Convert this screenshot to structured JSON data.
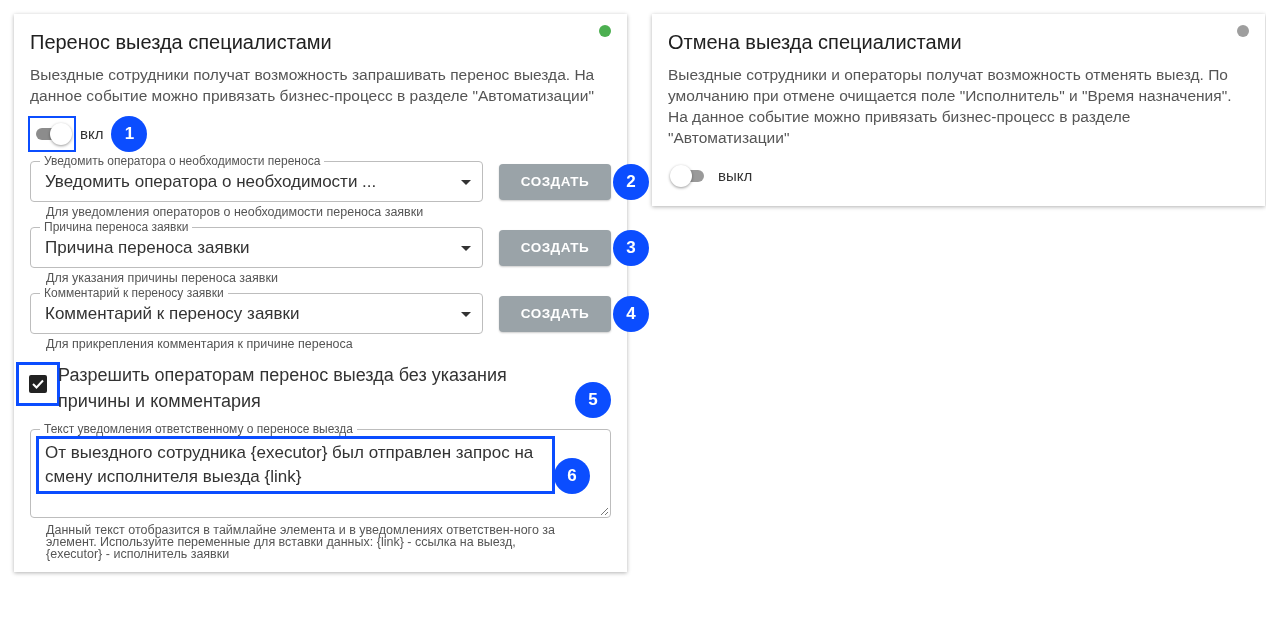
{
  "cards": [
    {
      "title": "Перенос выезда специалистами",
      "color": "#4caf50",
      "description": "Выездные сотрудники получат возможность запрашивать перенос выезда. На данное событие можно привязать бизнес-процесс в разделе \"Автоматизации\"",
      "toggle": {
        "label": "вкл",
        "on": true,
        "highlighted": true,
        "callout": "1"
      },
      "selects": [
        {
          "label": "Уведомить оператора о необходимости переноса",
          "value": "Уведомить оператора о необходимости ...",
          "helper": "Для уведомления операторов о необходимости переноса заявки",
          "button": "СОЗДАТЬ",
          "callout": "2"
        },
        {
          "label": "Причина переноса заявки",
          "value": "Причина переноса заявки",
          "helper": "Для указания причины переноса заявки",
          "button": "СОЗДАТЬ",
          "callout": "3"
        },
        {
          "label": "Комментарий к переносу заявки",
          "value": "Комментарий к переносу заявки",
          "helper": "Для прикрепления комментария к причине переноса",
          "button": "СОЗДАТЬ",
          "callout": "4"
        }
      ],
      "checkbox": {
        "label": "Разрешить операторам перенос выезда без указания причины и комментария",
        "checked": true,
        "highlighted": true,
        "callout": "5"
      },
      "textarea": {
        "label": "Текст уведомления ответственному о переносе выезда",
        "value": "От выездного сотрудника {executor} был отправлен запрос на смену исполнителя выезда {link}",
        "highlighted": true,
        "callout": "6",
        "helper": "Данный текст отобразится в таймлайне элемента и в уведомлениях ответствен-ного за элемент. Используйте переменные для вставки данных: {link} - ссылка на выезд, {executor} - исполнитель заявки"
      }
    },
    {
      "title": "Отмена выезда специалистами",
      "color": "#9e9e9e",
      "description": "Выездные сотрудники и операторы получат возможность отменять выезд. По умолчанию при отмене очищается поле \"Исполнитель\" и \"Время назначения\". На данное событие можно привязать бизнес-процесс в разделе \"Автоматизации\"",
      "toggle": {
        "label": "выкл",
        "on": false,
        "highlighted": false
      }
    }
  ]
}
